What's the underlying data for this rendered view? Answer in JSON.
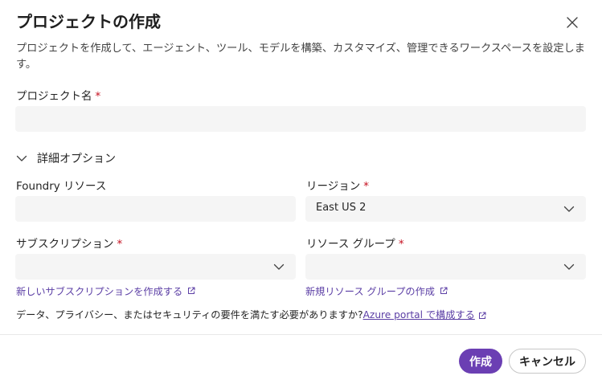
{
  "dialog": {
    "title": "プロジェクトの作成",
    "close_label": "",
    "description": "プロジェクトを作成して、エージェント、ツール、モデルを構築、カスタマイズ、管理できるワークスペースを設定します。"
  },
  "project_name": {
    "label": "プロジェクト名",
    "required_mark": "*",
    "value": ""
  },
  "advanced": {
    "label": "詳細オプション",
    "expanded": true
  },
  "foundry_resource": {
    "label": "Foundry リソース",
    "value": ""
  },
  "region": {
    "label": "リージョン",
    "required_mark": "*",
    "value": "East US 2"
  },
  "subscription": {
    "label": "サブスクリプション",
    "required_mark": "*",
    "value": "",
    "create_link": "新しいサブスクリプションを作成する"
  },
  "resource_group": {
    "label": "リソース グループ",
    "required_mark": "*",
    "value": "",
    "create_link": "新規リソース グループの作成"
  },
  "notice": {
    "text": "データ、プライバシー、またはセキュリティの要件を満たす必要がありますか?",
    "link": "Azure portal で構成する"
  },
  "footer": {
    "create_label": "作成",
    "cancel_label": "キャンセル"
  },
  "colors": {
    "accent": "#6b3fb3",
    "link": "#5b3ea5",
    "required": "#c50f1f",
    "field_bg": "#f5f5f5"
  }
}
